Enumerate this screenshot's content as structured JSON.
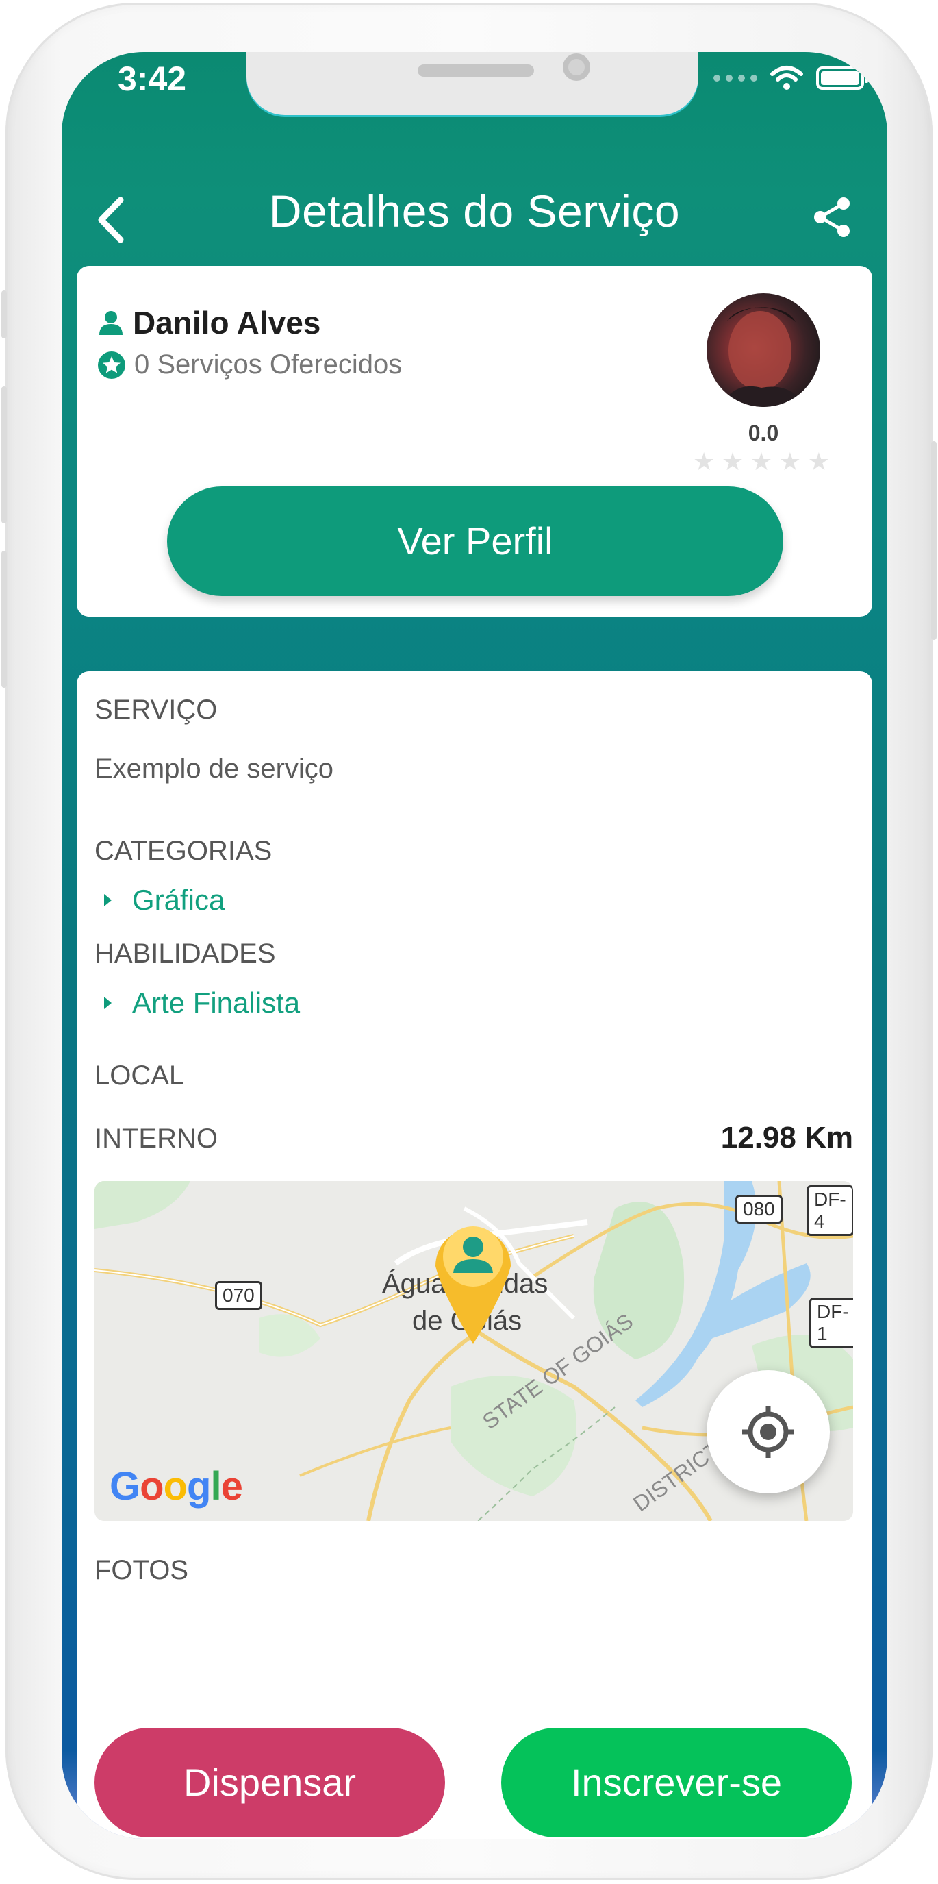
{
  "status_bar": {
    "time": "3:42"
  },
  "header": {
    "title": "Detalhes do Serviço"
  },
  "profile": {
    "name": "Danilo Alves",
    "services_offered": "0 Serviços Oferecidos",
    "rating": "0.0",
    "stars": 0,
    "stars_max": 5,
    "view_profile_label": "Ver Perfil"
  },
  "details": {
    "service_label": "SERVIÇO",
    "service_value": "Exemplo de serviço",
    "categories_label": "CATEGORIAS",
    "categories": [
      "Gráfica"
    ],
    "skills_label": "HABILIDADES",
    "skills": [
      "Arte Finalista"
    ],
    "location_label": "LOCAL",
    "location_type": "INTERNO",
    "distance": "12.98 Km",
    "photos_label": "FOTOS"
  },
  "map": {
    "city_line1": "Águas Lindas",
    "city_line2": "de Goiás",
    "road_070": "070",
    "road_080": "080",
    "road_df4": "DF-4",
    "road_df1": "DF-1",
    "state_label": "STATE OF GOIÁS",
    "district_label": "DISTRICT",
    "google": [
      "G",
      "o",
      "o",
      "g",
      "l",
      "e"
    ]
  },
  "actions": {
    "dismiss_label": "Dispensar",
    "subscribe_label": "Inscrever-se"
  },
  "colors": {
    "primary": "#0e9b7b",
    "dismiss": "#cd3c68",
    "subscribe": "#05c25a",
    "pin": "#f6bc2b"
  }
}
